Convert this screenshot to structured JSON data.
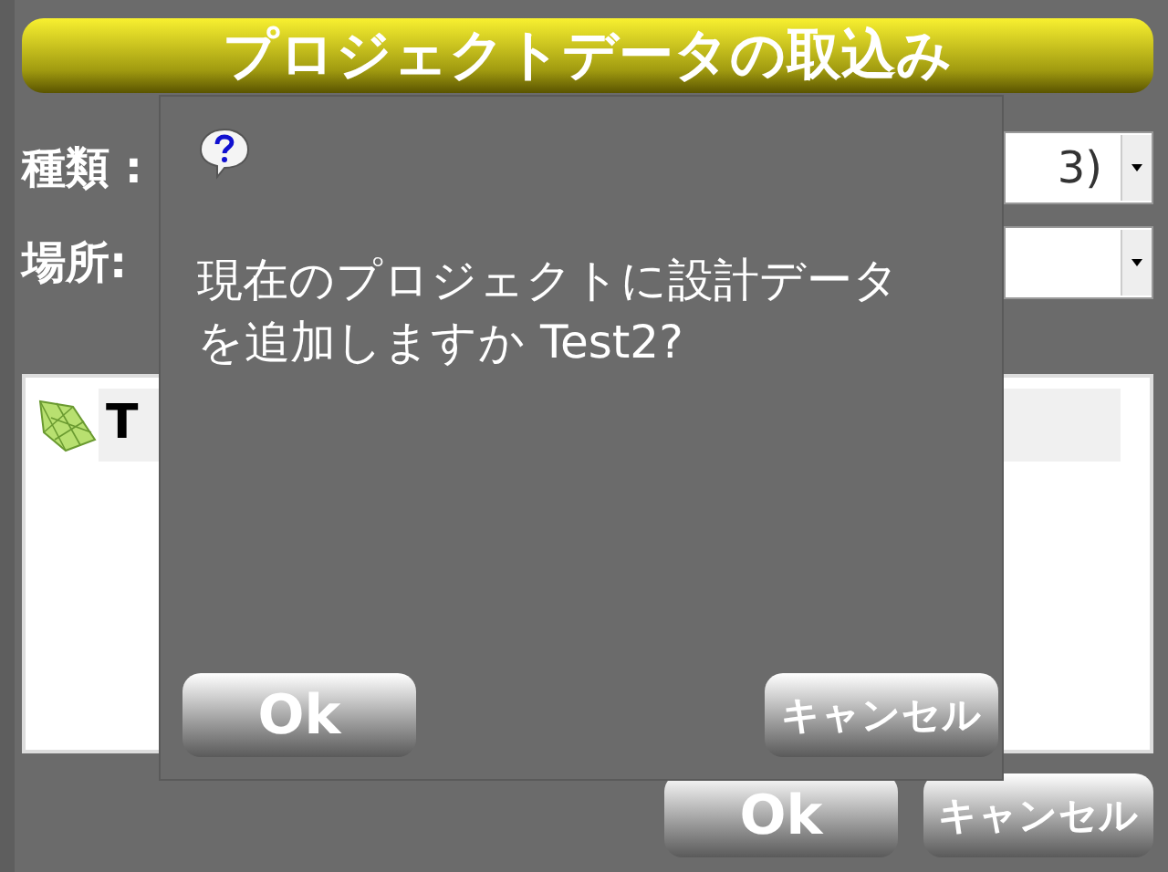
{
  "window": {
    "title": "プロジェクトデータの取込み"
  },
  "fields": [
    {
      "label": "種類 :",
      "value": "3)"
    },
    {
      "label": "場所:"
    }
  ],
  "list": {
    "items": [
      {
        "label": "T",
        "selected": true
      }
    ]
  },
  "buttons": [
    "Ok",
    "キャンセル"
  ],
  "dialog": {
    "message": "現在のプロジェクトに設計データを追加しますか Test2?",
    "buttons": [
      "Ok",
      "キャンセル"
    ]
  }
}
